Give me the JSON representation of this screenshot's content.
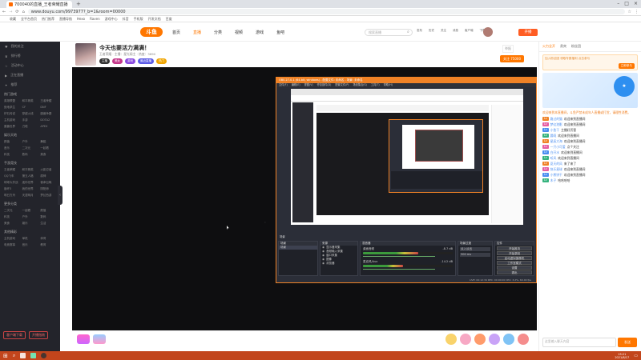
{
  "browser": {
    "tab_title": "700040的直播_王者荣耀直播",
    "url": "www.douyu.com/9973977?_b=1&room=00000",
    "bookmarks": [
      "收藏",
      "全平台首页",
      "热门推荐",
      "直播导航",
      "Hexo",
      "Raven",
      "游戏中心",
      "抖音",
      "手机版",
      "开发文档",
      "百度"
    ]
  },
  "site": {
    "logo": "斗鱼",
    "nav": [
      "首页",
      "直播",
      "分类",
      "视频",
      "游戏",
      "鱼吧"
    ],
    "search_placeholder": "搜索直播",
    "header_icons": [
      "发布",
      "历史",
      "关注",
      "消息",
      "客户端",
      "下载"
    ],
    "open_button": "开播"
  },
  "left_nav": {
    "items": [
      "我的关注",
      "排行榜",
      "活动中心",
      "正在直播",
      "推荐"
    ],
    "section_hot": "热门游戏",
    "hot_games": [
      "英雄联盟",
      "和平精英",
      "王者荣耀",
      "绝地求生",
      "CF",
      "DNF",
      "炉石传说",
      "穿越火线",
      "魔兽争霸",
      "主机游戏",
      "手游",
      "DOTA2",
      "魔兽世界",
      "刀塔",
      "APEX"
    ],
    "section_ent": "娱乐天地",
    "ent": [
      "颜值",
      "户外",
      "舞蹈",
      "音乐",
      "二次元",
      "一起看",
      "科技",
      "数码",
      "美食"
    ],
    "section_game": "手游竞技",
    "game": [
      "王者荣耀",
      "和平精英",
      "火影忍者",
      "QQ飞车",
      "第五人格",
      "原神",
      "球球大作战",
      "迷你世界",
      "使命召唤",
      "崩坏3",
      "我的世界",
      "阴阳师",
      "明日方舟",
      "天涯明月",
      "梦幻西游"
    ],
    "section_more": "更多分类",
    "more": [
      "二次元",
      "一起看",
      "颜值",
      "科技",
      "户外",
      "数码",
      "美食",
      "娱乐",
      "生活"
    ],
    "section_other": "其他精彩",
    "other": [
      "主机游戏",
      "单机",
      "体育",
      "电竞赛事",
      "音乐",
      "教育"
    ],
    "footer": [
      "客户端下载",
      "开播指南"
    ]
  },
  "stream": {
    "title": "今天也要活力满满！",
    "meta": "王者荣耀 · 主播：星光阁主 · 热度：3690",
    "tags": [
      "主播",
      "美女",
      "游戏",
      "最近直播",
      "热门"
    ],
    "follow": "关注",
    "follow_count": "75000",
    "report": "举报"
  },
  "obs": {
    "title": "OBS 27.0.1 (64-bit, windows) - 配置文件: 未命名 - 场景: 未命名",
    "menu": [
      "文件(F)",
      "编辑(E)",
      "视图(V)",
      "停靠部件(D)",
      "配置文件(P)",
      "场景集合(S)",
      "工具(T)",
      "帮助(H)"
    ],
    "panels": {
      "scenes": "场景",
      "sources": "来源",
      "mixer": "混音器",
      "transitions": "场景过渡",
      "controls": "控件"
    },
    "scene_items": [
      "场景"
    ],
    "source_items": [
      "显示器采集",
      "音频输入采集",
      "窗口采集",
      "图像",
      "浏览器"
    ],
    "mixer_tracks": [
      {
        "name": "桌面音频",
        "db": "-8.7 dB",
        "level": 0.62
      },
      {
        "name": "麦克风/Aux",
        "db": "-14.2 dB",
        "level": 0.45
      }
    ],
    "transition": "淡入淡出",
    "duration": "300 ms",
    "controls": [
      "开始推流",
      "开始录制",
      "启动虚拟摄像机",
      "工作室模式",
      "设置",
      "退出"
    ],
    "status": "LIVE: 00:12:34   REC: 00:00:00   CPU: 3.2%, 60.00 fps"
  },
  "chat": {
    "tabs": [
      "火力全开",
      "贵宾",
      "粉丝团"
    ],
    "banner": "加入粉丝团 领取专属福利 点击参与",
    "join": "立即参与",
    "notice": "欢迎来到本直播间，斗鱼严禁未成年人直播或打赏，请理性消费。",
    "messages": [
      {
        "user": "路过的猫",
        "text": "欢迎来到直播间"
      },
      {
        "user": "梦幻泡影",
        "text": "欢迎来到直播间"
      },
      {
        "user": "小鱼干",
        "text": "主播好厉害"
      },
      {
        "user": "晨曦",
        "text": "欢迎来到直播间"
      },
      {
        "user": "星辰大海",
        "text": "欢迎来到直播间"
      },
      {
        "user": "一只小可爱",
        "text": "点个关注"
      },
      {
        "user": "白开水",
        "text": "欢迎来到直播间"
      },
      {
        "user": "听风",
        "text": "欢迎来到直播间"
      },
      {
        "user": "夏天的风",
        "text": "来了来了"
      },
      {
        "user": "快乐星球",
        "text": "欢迎来到直播间"
      },
      {
        "user": "小熊饼干",
        "text": "欢迎来到直播间"
      },
      {
        "user": "木子",
        "text": "哈哈哈哈"
      }
    ],
    "input_placeholder": "这里输入聊天内容",
    "send": "发送"
  },
  "taskbar": {
    "time": "15:21",
    "date": "2021/8/17"
  }
}
